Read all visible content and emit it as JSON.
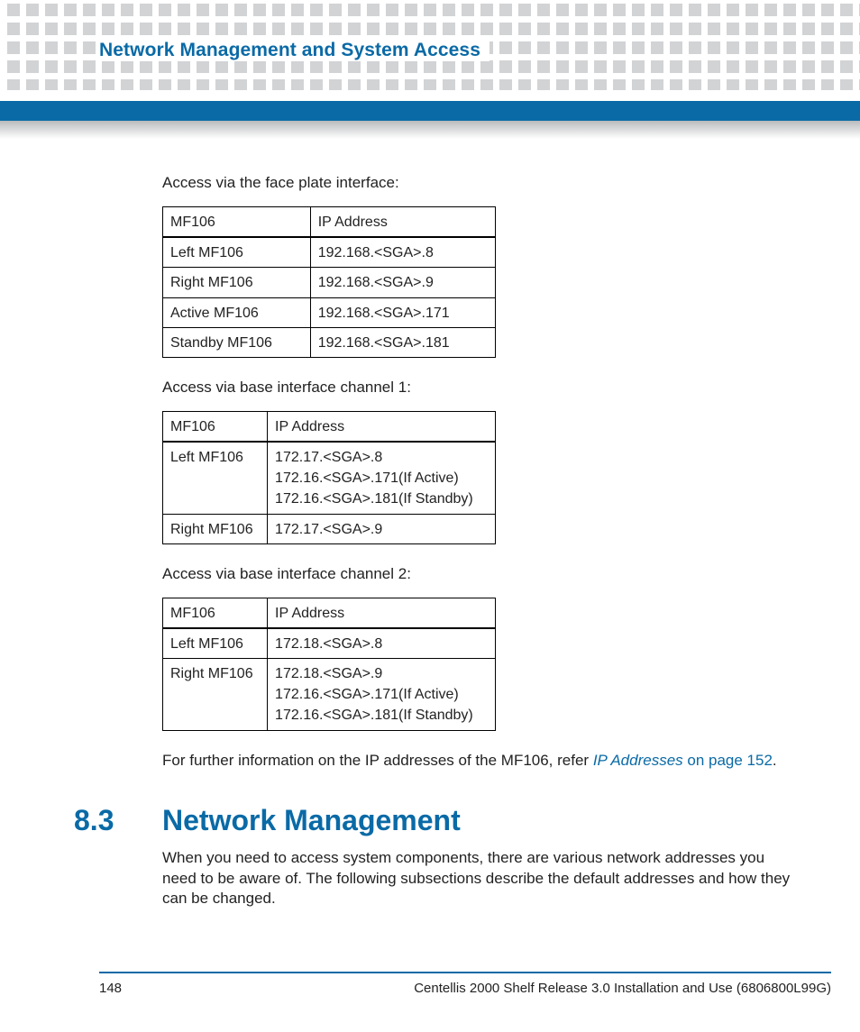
{
  "header": {
    "chapter_title": "Network Management and System Access"
  },
  "body": {
    "para1": "Access via the face plate interface:",
    "table1": {
      "headers": [
        "MF106",
        "IP Address"
      ],
      "rows": [
        [
          "Left MF106",
          "192.168.<SGA>.8"
        ],
        [
          "Right MF106",
          "192.168.<SGA>.9"
        ],
        [
          "Active MF106",
          "192.168.<SGA>.171"
        ],
        [
          "Standby MF106",
          "192.168.<SGA>.181"
        ]
      ]
    },
    "para2": "Access via base interface channel 1:",
    "table2": {
      "headers": [
        "MF106",
        "IP Address"
      ],
      "rows": [
        [
          "Left MF106",
          "172.17.<SGA>.8\n172.16.<SGA>.171(If Active)\n172.16.<SGA>.181(If Standby)"
        ],
        [
          "Right MF106",
          "172.17.<SGA>.9"
        ]
      ]
    },
    "para3": "Access via base interface channel 2:",
    "table3": {
      "headers": [
        "MF106",
        "IP Address"
      ],
      "rows": [
        [
          "Left MF106",
          "172.18.<SGA>.8"
        ],
        [
          "Right MF106",
          "172.18.<SGA>.9\n172.16.<SGA>.171(If Active)\n172.16.<SGA>.181(If Standby)"
        ]
      ]
    },
    "para4_prefix": "For further information on the IP addresses of the MF106, refer ",
    "para4_link_italic": "IP Addresses",
    "para4_link_rest": " on page 152",
    "para4_suffix": ".",
    "section": {
      "num": "8.3",
      "title": "Network Management",
      "text": "When you need to access system components, there are various network addresses you need to be aware of. The following subsections describe the default addresses and how they can be changed."
    }
  },
  "footer": {
    "page_number": "148",
    "doc_title": "Centellis 2000 Shelf Release 3.0 Installation and Use (6806800L99G)"
  }
}
